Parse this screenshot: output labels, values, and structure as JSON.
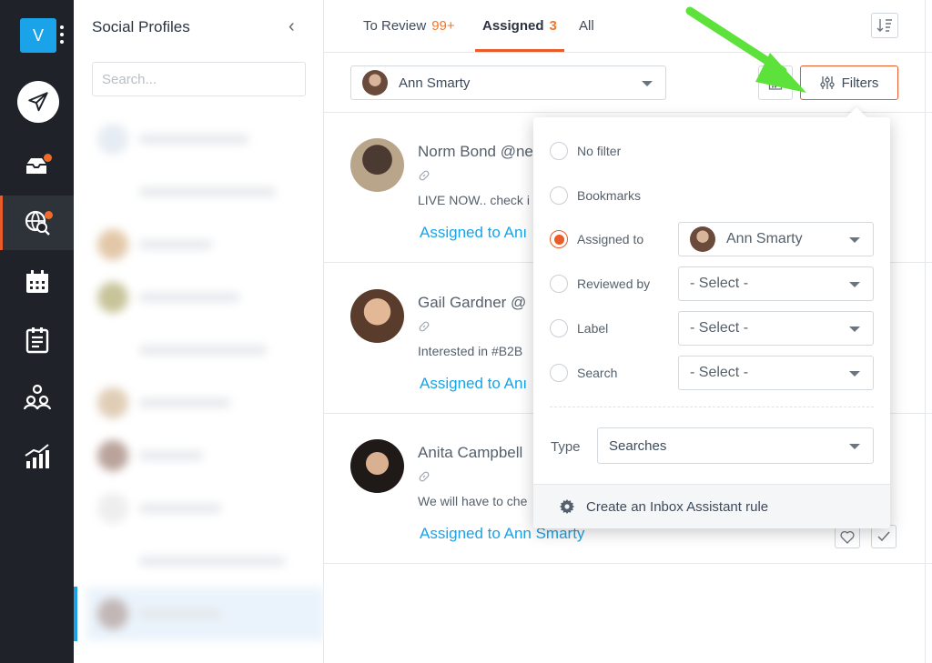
{
  "rail": {
    "logo_letter": "V",
    "items": [
      "compose",
      "inbox",
      "listening",
      "calendar",
      "planner",
      "team",
      "analytics"
    ]
  },
  "profiles": {
    "title": "Social Profiles",
    "search_placeholder": "Search..."
  },
  "tabs": [
    {
      "label": "To Review",
      "count": "99+"
    },
    {
      "label": "Assigned",
      "count": "3"
    },
    {
      "label": "All",
      "count": ""
    }
  ],
  "toolbar": {
    "selected_user": "Ann Smarty",
    "filters_label": "Filters"
  },
  "posts": [
    {
      "name": "Norm Bond @ne",
      "text": "LIVE NOW.. check i",
      "assigned": "Assigned to Anı"
    },
    {
      "name": "Gail Gardner @",
      "text": "Interested in #B2B",
      "assigned": "Assigned to Anı"
    },
    {
      "name": "Anita Campbell",
      "text": "We will have to che",
      "assigned": "Assigned to Ann Smarty"
    }
  ],
  "filter_panel": {
    "options": [
      {
        "label": "No filter",
        "selected": false,
        "select_value": ""
      },
      {
        "label": "Bookmarks",
        "selected": false,
        "select_value": ""
      },
      {
        "label": "Assigned to",
        "selected": true,
        "select_value": "Ann Smarty"
      },
      {
        "label": "Reviewed by",
        "selected": false,
        "select_value": "- Select -"
      },
      {
        "label": "Label",
        "selected": false,
        "select_value": "- Select -"
      },
      {
        "label": "Search",
        "selected": false,
        "select_value": "- Select -"
      }
    ],
    "type_label": "Type",
    "type_value": "Searches",
    "footer_label": "Create an Inbox Assistant rule"
  },
  "colors": {
    "accent": "#ea5b2a",
    "link": "#1aa3e8",
    "rail": "#1f2329",
    "arrow": "#5ce23a"
  }
}
